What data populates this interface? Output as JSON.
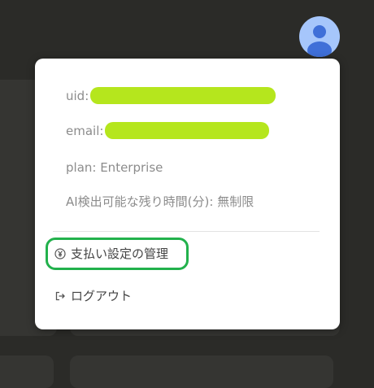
{
  "account": {
    "uid_label": "uid:",
    "email_label": "email:",
    "plan_text": "plan: Enterprise",
    "ai_time_text": "AI検出可能な残り時間(分): 無制限"
  },
  "menu": {
    "billing_label": "支払い設定の管理",
    "billing_icon": "yen-circle-icon",
    "logout_label": "ログアウト",
    "logout_icon": "logout-icon"
  },
  "colors": {
    "redaction": "#b5e61d",
    "highlight": "#22b14c",
    "avatar_bg": "#a6c6fb",
    "avatar_fg": "#3f6fd8"
  }
}
